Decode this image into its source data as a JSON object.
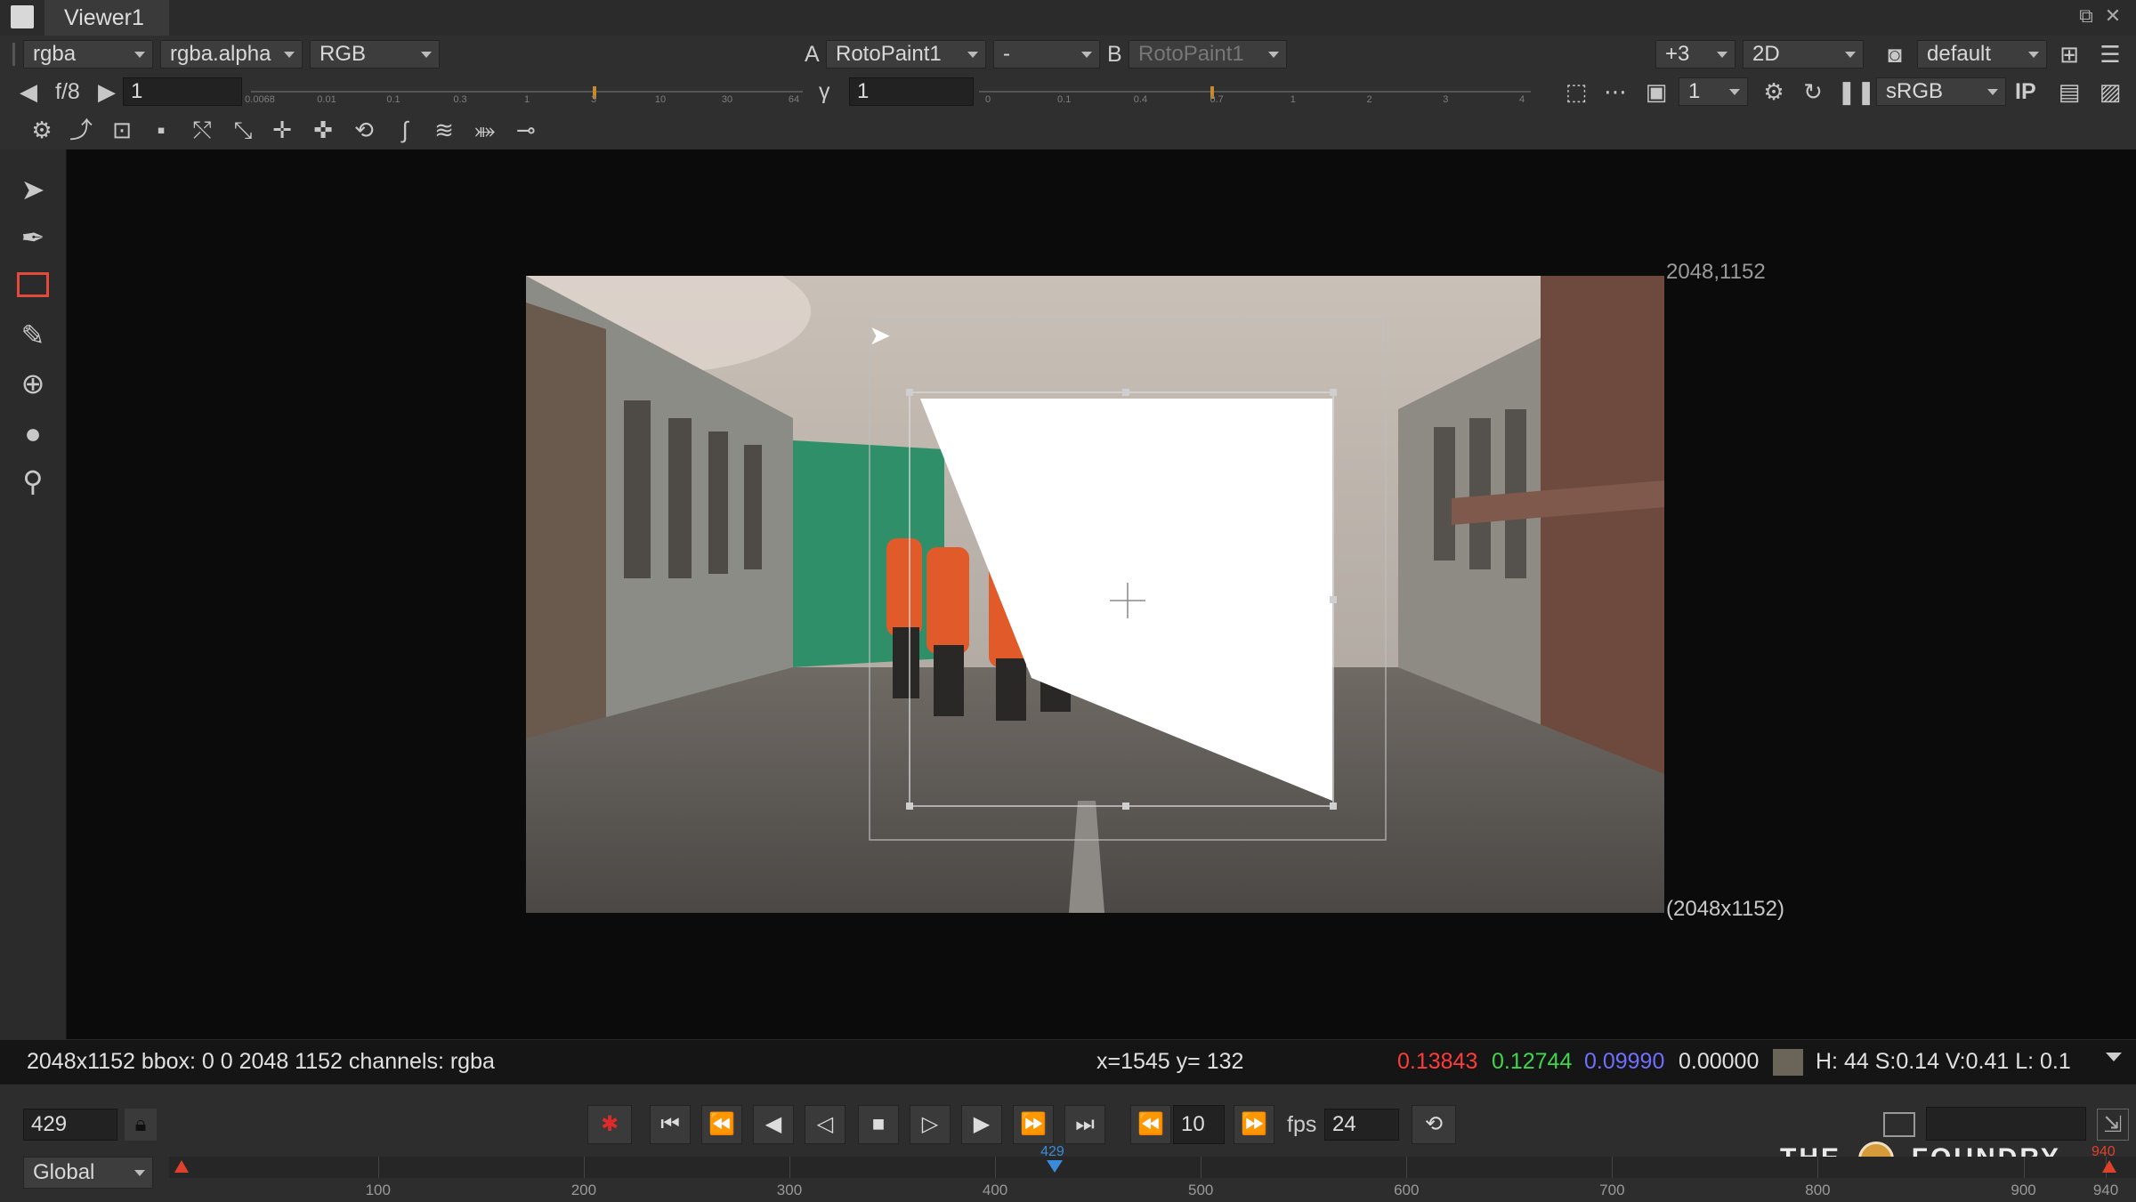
{
  "window": {
    "tab_title": "Viewer1"
  },
  "toolbar": {
    "channels": "rgba",
    "alpha_channel": "rgba.alpha",
    "display_channels": "RGB",
    "input_a_label": "A",
    "input_a": "RotoPaint1",
    "compare_mode": "-",
    "input_b_label": "B",
    "input_b": "RotoPaint1",
    "zoom": "+3",
    "view_mode": "2D",
    "lut_default": "default",
    "proxy_scale": "f/8",
    "frame_value": "1",
    "gamma_label": "γ",
    "gamma_value": "1",
    "downrez": "1",
    "colorspace": "sRGB",
    "ip_label": "IP",
    "gain_ticks": [
      "0.0068",
      "0.01",
      "0.1",
      "0.3",
      "1",
      "3",
      "10",
      "30",
      "64"
    ],
    "gamma_ticks": [
      "0",
      "0.1",
      "0.4",
      "0.7",
      "1",
      "2",
      "3",
      "4"
    ],
    "gain_level": 0.62,
    "gamma_level": 0.42
  },
  "viewer": {
    "top_right_coord": "2048,1152",
    "format_label": "(2048x1152)"
  },
  "status": {
    "info": "2048x1152 bbox: 0 0 2048 1152 channels: rgba",
    "coords": "x=1545 y= 132",
    "r": "0.13843",
    "g": "0.12744",
    "b": "0.09990",
    "a": "0.00000",
    "hsv": "H: 44 S:0.14 V:0.41  L: 0.1",
    "swatch_color": "#6b6459"
  },
  "transport": {
    "current_frame": "429",
    "skip_frames": "10",
    "fps_label": "fps",
    "fps_value": "24",
    "range_mode": "Global",
    "playhead_label": "429",
    "out_marker_label": "940",
    "timeline_ticks": [
      "100",
      "200",
      "300",
      "400",
      "500",
      "600",
      "700",
      "800",
      "900",
      "940"
    ],
    "brand_left": "THE",
    "brand_right": "FOUNDRY"
  },
  "colors": {
    "accent": "#c98a2c",
    "red_value": "#ff3b3b",
    "green_value": "#3ed64a",
    "blue_value": "#5a5aff",
    "playhead": "#3a8bdc",
    "marker": "#e0412c"
  }
}
